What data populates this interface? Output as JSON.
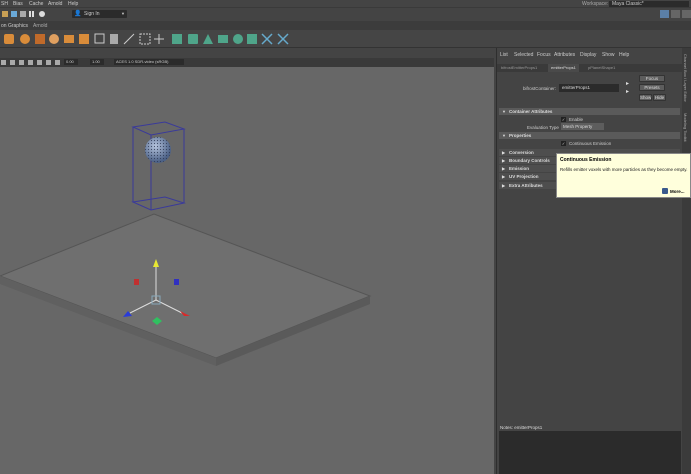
{
  "menubar": {
    "items": [
      "SH",
      "Bias",
      "Cache",
      "Arnold",
      "Help"
    ],
    "workspace_label": "Workspace:",
    "workspace_value": "Maya Classic*"
  },
  "shelfbar": {
    "sign_in": "Sign In"
  },
  "tabsrow": {
    "tabs": [
      "on Graphics",
      "Arnold"
    ]
  },
  "viewport_toolbar": {
    "value1": "0.00",
    "value2": "1.00",
    "colorspace": "ACES 1.0 SDR-video (sRGB)"
  },
  "attribute_editor": {
    "menu": [
      "List",
      "Selected",
      "Focus",
      "Attributes",
      "Display",
      "Show",
      "Help"
    ],
    "tabs": [
      "bifrostEmitterProps1",
      "emitterProps1",
      "pPlanetShape1"
    ],
    "container_label": "bifrostContainer:",
    "container_value": "emitterProps1",
    "focus_btn": "Focus",
    "presets_btn": "Presets",
    "show_btn": "Show",
    "hide_btn": "Hide",
    "sections": {
      "container_attributes": "Container Attributes",
      "enable_label": "Enable",
      "evaluation_type_label": "Evaluation Type",
      "evaluation_type_value": "Mesh Property",
      "properties": "Properties",
      "continuous_emission_label": "Continuous Emission",
      "conversion": "Conversion",
      "boundary_controls": "Boundary Controls",
      "emission": "Emission",
      "uv_projection": "UV Projection",
      "extra_attributes": "Extra Attributes"
    },
    "notes_label": "Notes:  emitterProps1"
  },
  "tooltip": {
    "title": "Continuous Emission",
    "body": "Refills emitter voxels with more particles as they become empty.",
    "more": "More..."
  },
  "side_tabs": [
    "Channel Box / Layer Editor",
    "Modeling Toolkit"
  ]
}
